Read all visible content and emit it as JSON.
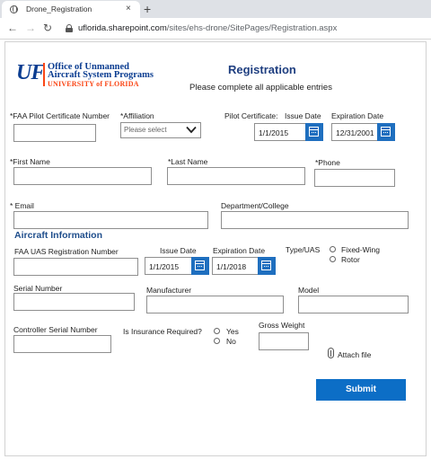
{
  "browser": {
    "tab_title": "Drone_Registration",
    "tab_close": "×",
    "new_tab": "+",
    "back": "←",
    "forward": "→",
    "reload": "↻",
    "url_host": "uflorida.sharepoint.com",
    "url_path": "/sites/ehs-drone/SitePages/Registration.aspx"
  },
  "logo": {
    "mark": "UF",
    "line1": "Office of Unmanned",
    "line2": "Aircraft System Programs",
    "line3": "UNIVERSITY of FLORIDA"
  },
  "header": {
    "title": "Registration",
    "subtitle": "Please complete all applicable entries"
  },
  "fields": {
    "faa_pilot_cert_label": "*FAA Pilot Certificate Number",
    "affiliation_label": "*Affiliation",
    "affiliation_placeholder": "Please select",
    "pilot_cert_label": "Pilot Certificate:",
    "issue_date_label": "Issue Date",
    "pilot_issue_date": "1/1/2015",
    "expiration_date_label": "Expiration Date",
    "pilot_expiration_date": "12/31/2001",
    "first_name_label": "*First Name",
    "last_name_label": "*Last Name",
    "phone_label": "*Phone",
    "email_label": "* Email",
    "department_label": "Department/College"
  },
  "aircraft": {
    "section_title": "Aircraft Information",
    "uas_reg_label": "FAA UAS Registration Number",
    "issue_date_label": "Issue Date",
    "issue_date": "1/1/2015",
    "expiration_date_label": "Expiration Date",
    "expiration_date": "1/1/2018",
    "type_label": "Type/UAS",
    "type_options": [
      "Fixed-Wing",
      "Rotor"
    ],
    "serial_label": "Serial Number",
    "manufacturer_label": "Manufacturer",
    "model_label": "Model",
    "controller_serial_label": "Controller Serial Number",
    "insurance_label": "Is Insurance Required?",
    "insurance_options": [
      "Yes",
      "No"
    ],
    "gross_weight_label": "Gross Weight",
    "attach_label": "Attach file"
  },
  "actions": {
    "submit_label": "Submit"
  },
  "colors": {
    "accent_blue": "#0c6ec6",
    "title_blue": "#1f3f80",
    "uf_blue": "#0b3d91",
    "uf_orange": "#fa4616"
  }
}
